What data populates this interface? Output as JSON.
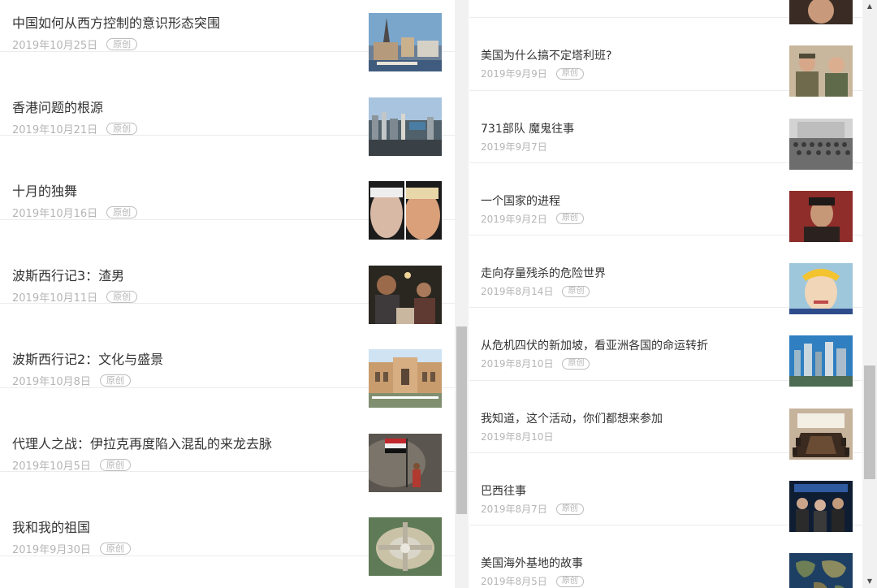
{
  "badge_label": "原创",
  "left_articles": [
    {
      "title": "中国如何从西方控制的意识形态突围",
      "date": "2019年10月25日",
      "badge": true,
      "thumb": "city-cathedral"
    },
    {
      "title": "香港问题的根源",
      "date": "2019年10月21日",
      "badge": true,
      "thumb": "harbor-skyline"
    },
    {
      "title": "十月的独舞",
      "date": "2019年10月16日",
      "badge": true,
      "thumb": "two-leaders-portrait"
    },
    {
      "title": "波斯西行记3：渣男",
      "date": "2019年10月11日",
      "badge": true,
      "thumb": "night-dining-people"
    },
    {
      "title": "波斯西行记2：文化与盛景",
      "date": "2019年10月8日",
      "badge": true,
      "thumb": "persian-palace"
    },
    {
      "title": "代理人之战：伊拉克再度陷入混乱的来龙去脉",
      "date": "2019年10月5日",
      "badge": true,
      "thumb": "iraq-flag-smoke"
    },
    {
      "title": "我和我的祖国",
      "date": "2019年9月30日",
      "badge": true,
      "thumb": "airport-aerial"
    }
  ],
  "right_articles": [
    {
      "title": "",
      "date": "",
      "badge": false,
      "thumb": "portrait-partial"
    },
    {
      "title": "美国为什么搞不定塔利班?",
      "date": "2019年9月9日",
      "badge": true,
      "thumb": "soldiers-portrait"
    },
    {
      "title": "731部队 魔鬼往事",
      "date": "2019年9月7日",
      "badge": false,
      "thumb": "historic-group-photo"
    },
    {
      "title": "一个国家的进程",
      "date": "2019年9月2日",
      "badge": true,
      "thumb": "asian-portrait-red"
    },
    {
      "title": "走向存量残杀的危险世界",
      "date": "2019年8月14日",
      "badge": true,
      "thumb": "trump-caricature"
    },
    {
      "title": "从危机四伏的新加坡，看亚洲各国的命运转折",
      "date": "2019年8月10日",
      "badge": true,
      "thumb": "singapore-skyline"
    },
    {
      "title": "我知道，这个活动，你们都想来参加",
      "date": "2019年8月10日",
      "badge": false,
      "thumb": "conference-room"
    },
    {
      "title": "巴西往事",
      "date": "2019年8月7日",
      "badge": true,
      "thumb": "cinema-audience"
    },
    {
      "title": "美国海外基地的故事",
      "date": "2019年8月5日",
      "badge": true,
      "thumb": "world-map-satellite"
    }
  ]
}
